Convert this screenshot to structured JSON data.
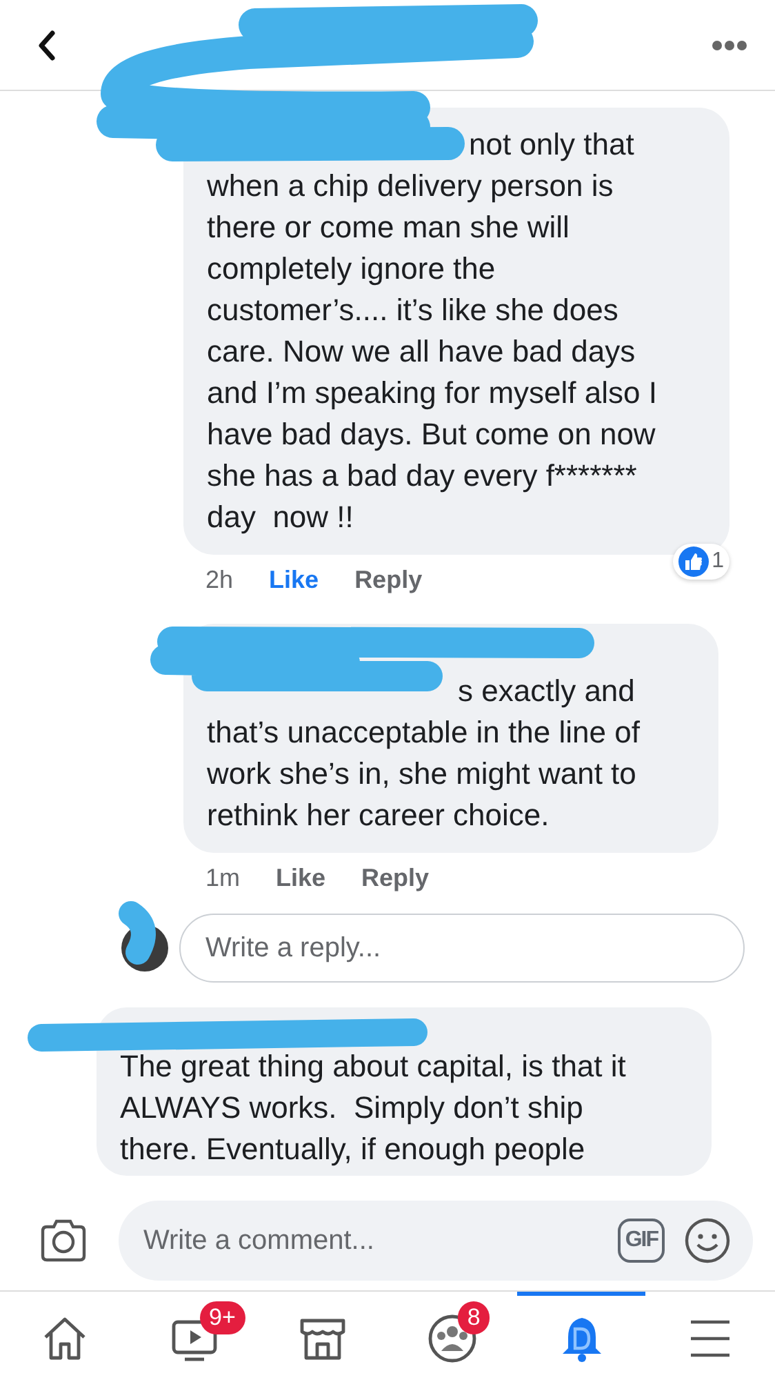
{
  "comments": [
    {
      "text": "not only that\nwhen a chip delivery person is\nthere or come man she will\ncompletely ignore the\ncustomer’s.... it’s like she does\ncare. Now we all have bad days\nand I’m speaking for myself also I\nhave bad days. But come on now\nshe has a bad day every f*******\nday  now !!",
      "time": "2h",
      "like": "Like",
      "liked": true,
      "reply": "Reply",
      "reactions": "1"
    },
    {
      "text": "s exactly and\nthat’s unacceptable in the line of\nwork she’s in, she might want to\nrethink her career choice.",
      "time": "1m",
      "like": "Like",
      "liked": false,
      "reply": "Reply"
    }
  ],
  "reply_field": {
    "placeholder": "Write a reply..."
  },
  "next_comment": {
    "text": "The great thing about capital, is that it\nALWAYS works.  Simply don’t ship\nthere. Eventually, if enough people"
  },
  "comment_field": {
    "placeholder": "Write a comment...",
    "gif": "GIF"
  },
  "tabs": [
    {
      "kind": "home",
      "selected": false
    },
    {
      "kind": "video",
      "selected": false,
      "badge": "9+"
    },
    {
      "kind": "marketplace",
      "selected": false
    },
    {
      "kind": "groups",
      "selected": false,
      "badge": "8"
    },
    {
      "kind": "notifications",
      "selected": true
    },
    {
      "kind": "menu",
      "selected": false
    }
  ]
}
